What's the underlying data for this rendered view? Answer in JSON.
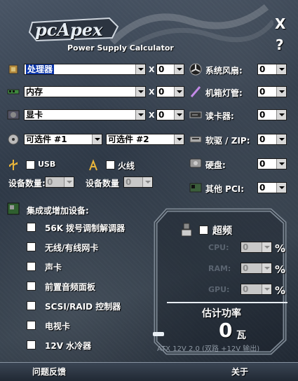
{
  "window": {
    "close": "X",
    "help": "?"
  },
  "logo": {
    "brand": "pcApex",
    "subtitle": "Power Supply Calculator"
  },
  "left": {
    "cpu": {
      "value": "处理器",
      "qty": "0",
      "x": "X"
    },
    "memory": {
      "value": "内存",
      "qty": "0",
      "x": "X"
    },
    "gpu": {
      "value": "显卡",
      "qty": "0",
      "x": "X"
    },
    "optional1": {
      "value": "可选件 #1"
    },
    "optional2": {
      "value": "可选件 #2"
    },
    "usb": {
      "label": "USB",
      "count_label": "设备数量:",
      "count": "0"
    },
    "firewire": {
      "label": "火线",
      "count_label": "设备数量",
      "count": "0"
    }
  },
  "right": {
    "fans": {
      "label": "系统风扇:",
      "value": "0"
    },
    "cold_cathode": {
      "label": "机箱灯管:",
      "value": "0"
    },
    "card_reader": {
      "label": "读卡器:",
      "value": "0"
    },
    "floppy_zip": {
      "label": "软驱 / ZIP:",
      "value": "0"
    },
    "hdd": {
      "label": "硬盘:",
      "value": "0"
    },
    "pci": {
      "label": "其他 PCI:",
      "value": "0"
    }
  },
  "integrated": {
    "title": "集成或增加设备:",
    "items": [
      "56K 拨号调制解调器",
      "无线/有线网卡",
      "声卡",
      "前置音频面板",
      "SCSI/RAID 控制器",
      "电视卡",
      "12V 水冷器"
    ]
  },
  "overclock": {
    "label": "超频",
    "cpu_label": "CPU:",
    "cpu_value": "0",
    "ram_label": "RAM:",
    "ram_value": "0",
    "gpu_label": "GPU:",
    "gpu_value": "0",
    "percent": "%"
  },
  "result": {
    "title": "估计功率",
    "watts": "0",
    "unit": "瓦",
    "note": "ATX 12V 2.0 (双路 +12V 输出)"
  },
  "footer": {
    "feedback": "问题反馈",
    "about": "关于"
  }
}
